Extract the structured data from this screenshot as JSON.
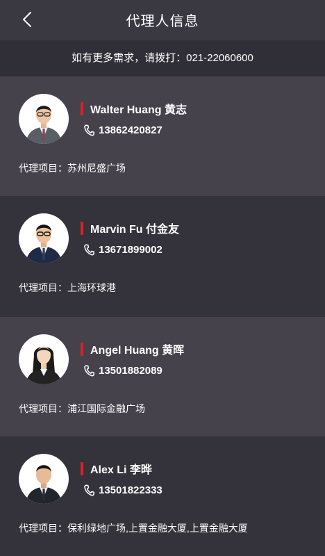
{
  "header": {
    "title": "代理人信息",
    "back_icon": "chevron-left-icon"
  },
  "notice": {
    "text": "如有更多需求，请拨打：021-22060600"
  },
  "colors": {
    "background": "#3a3841",
    "card": "#45424c",
    "card_alt": "#34323a",
    "notice_bar": "#302e36",
    "accent": "#d6232a"
  },
  "agents": [
    {
      "name": "Walter Huang 黄志",
      "phone": "13862420827",
      "project": "代理项目：苏州尼盛广场",
      "phone_icon": "phone-icon"
    },
    {
      "name": "Marvin Fu 付金友",
      "phone": "13671899002",
      "project": "代理项目：上海环球港",
      "phone_icon": "phone-icon"
    },
    {
      "name": "Angel Huang 黄晖",
      "phone": "13501882089",
      "project": "代理项目：浦江国际金融广场",
      "phone_icon": "phone-icon"
    },
    {
      "name": "Alex Li 李晔",
      "phone": "13501822333",
      "project": "代理项目：保利绿地广场,上置金融大厦,上置金融大厦",
      "phone_icon": "phone-icon"
    }
  ]
}
